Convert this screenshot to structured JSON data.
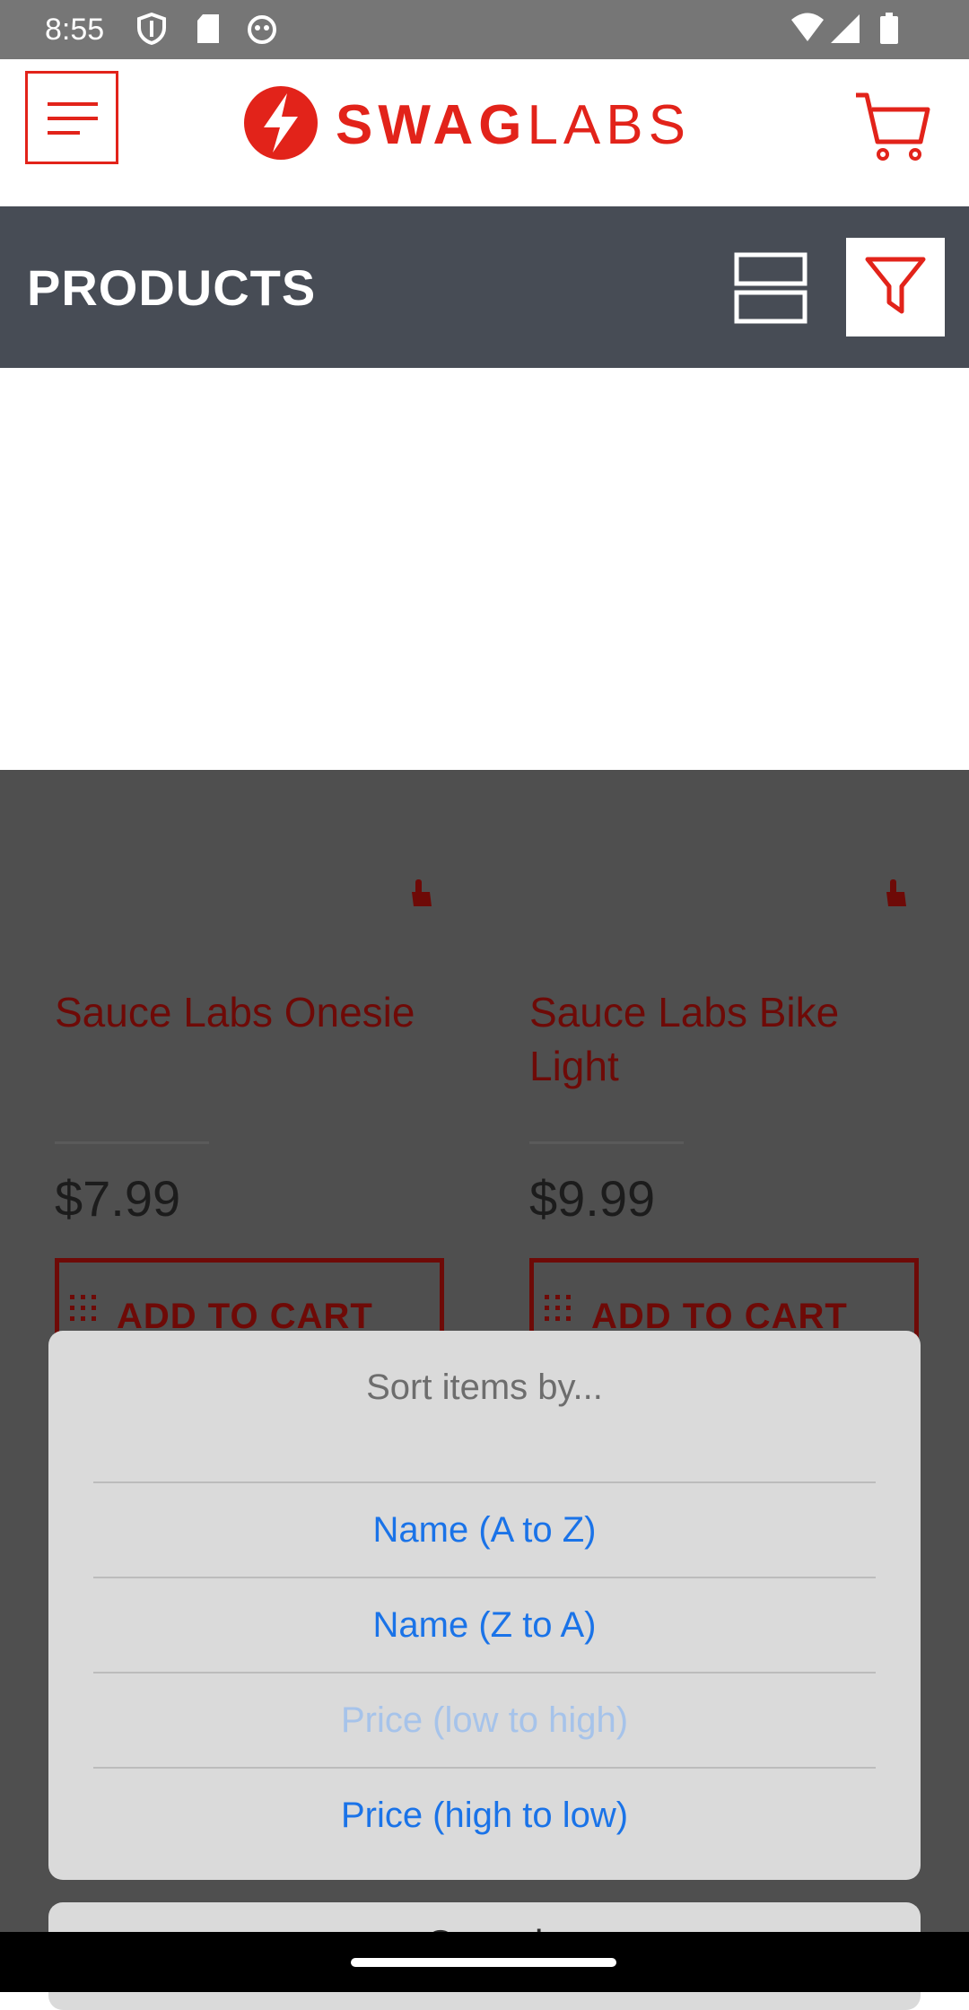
{
  "status_bar": {
    "time": "8:55",
    "icons": [
      "shield-icon",
      "sd-card-icon",
      "android-debug-icon",
      "wifi-icon",
      "signal-icon",
      "battery-icon"
    ]
  },
  "app_bar": {
    "logo_text_bold": "SWAG",
    "logo_text_light": "LABS",
    "menu_icon": "hamburger-menu-icon",
    "cart_icon": "shopping-cart-icon"
  },
  "header": {
    "title": "PRODUCTS",
    "layout_icon": "layout-toggle-icon",
    "filter_icon": "filter-funnel-icon"
  },
  "products": [
    {
      "name": "Sauce Labs Onesie",
      "price": "$7.99",
      "button_label": "ADD TO CART"
    },
    {
      "name": "Sauce Labs Bike Light",
      "price": "$9.99",
      "button_label": "ADD TO CART"
    }
  ],
  "sort_sheet": {
    "title": "Sort items by...",
    "options": [
      {
        "label": "Name (A to Z)",
        "enabled": true
      },
      {
        "label": "Name (Z to A)",
        "enabled": true
      },
      {
        "label": "Price (low to high)",
        "enabled": false
      },
      {
        "label": "Price (high to low)",
        "enabled": true
      }
    ],
    "cancel_label": "Cancel"
  },
  "colors": {
    "brand_red": "#e2231a",
    "header_bg": "#474c55",
    "option_blue": "#1a73e8",
    "status_bar_bg": "#767676"
  }
}
